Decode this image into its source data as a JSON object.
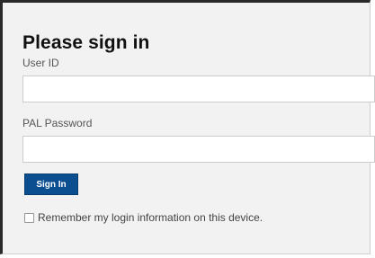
{
  "login": {
    "title": "Please sign in",
    "user_id": {
      "label": "User ID",
      "value": "",
      "placeholder": ""
    },
    "password": {
      "label": "PAL Password",
      "value": "",
      "placeholder": ""
    },
    "sign_in_label": "Sign In",
    "remember": {
      "label": "Remember my login information on this device.",
      "checked": false
    },
    "colors": {
      "button": "#0b4f91",
      "panel": "#f2f2f2"
    }
  }
}
